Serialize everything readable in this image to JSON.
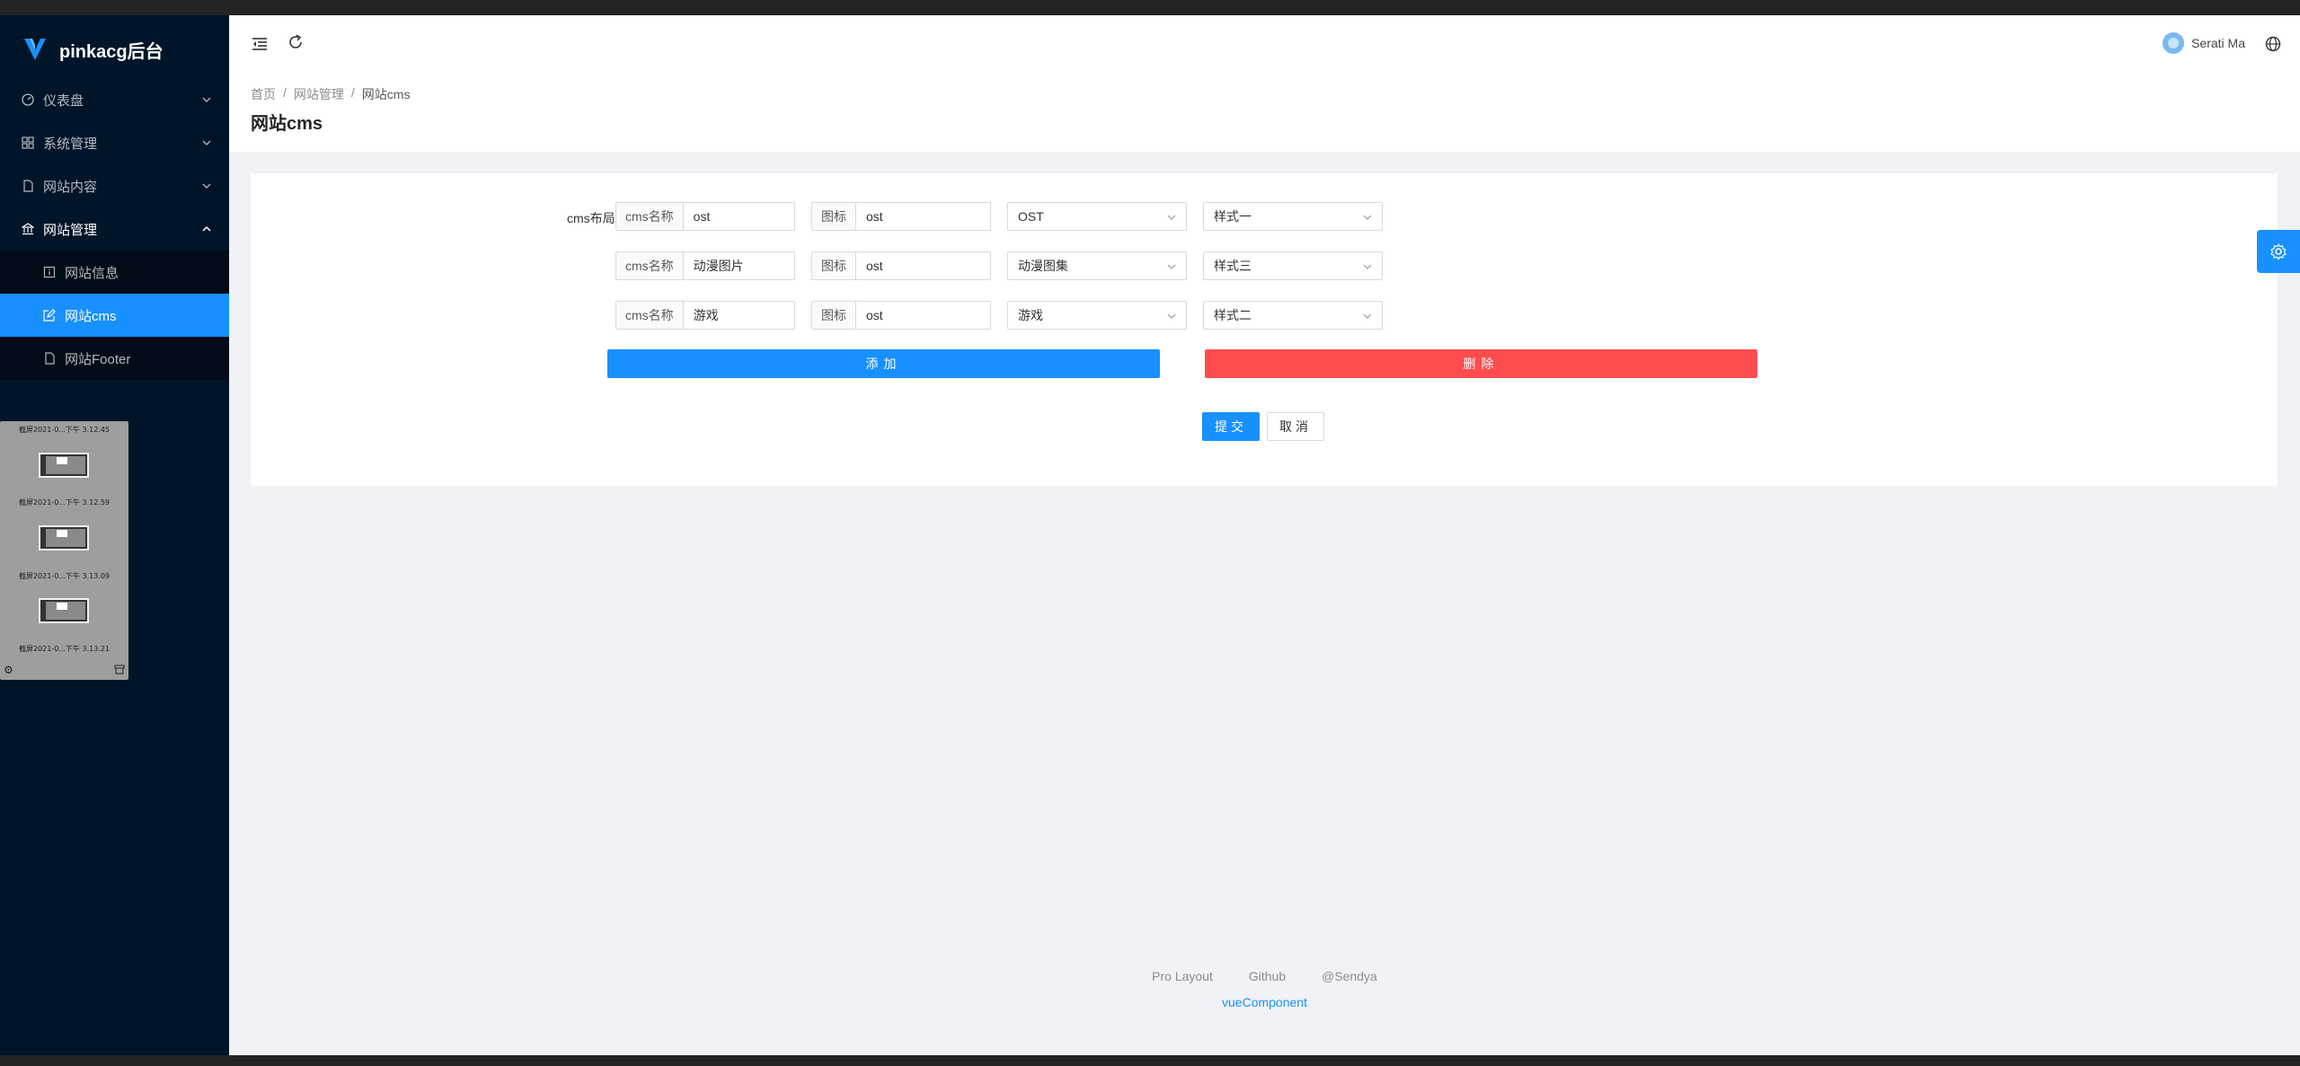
{
  "app": {
    "title": "pinkacg后台"
  },
  "sidebar": {
    "items": [
      {
        "label": "仪表盘",
        "icon": "dashboard-icon"
      },
      {
        "label": "系统管理",
        "icon": "appstore-icon"
      },
      {
        "label": "网站内容",
        "icon": "file-icon"
      },
      {
        "label": "网站管理",
        "icon": "bank-icon"
      }
    ],
    "subitems": [
      {
        "label": "网站信息",
        "icon": "info-icon"
      },
      {
        "label": "网站cms",
        "icon": "edit-icon"
      },
      {
        "label": "网站Footer",
        "icon": "file-icon"
      }
    ]
  },
  "screenshot_stack": {
    "captions": [
      "截屏2021-0...下午 3.12.45",
      "截屏2021-0...下午 3.12.59",
      "截屏2021-0...下午 3.13.09",
      "截屏2021-0...下午 3.13.21"
    ]
  },
  "header": {
    "user_name": "Serati Ma"
  },
  "breadcrumb": {
    "home": "首页",
    "section": "网站管理",
    "current": "网站cms"
  },
  "page": {
    "title": "网站cms"
  },
  "form": {
    "label": "cms布局:",
    "name_addon": "cms名称",
    "icon_addon": "图标",
    "rows": [
      {
        "name": "ost",
        "icon": "ost",
        "category": "OST",
        "style": "样式一"
      },
      {
        "name": "动漫图片",
        "icon": "ost",
        "category": "动漫图集",
        "style": "样式三"
      },
      {
        "name": "游戏",
        "icon": "ost",
        "category": "游戏",
        "style": "样式二"
      }
    ],
    "add_label": "添加",
    "delete_label": "删除",
    "submit_label": "提交",
    "cancel_label": "取消"
  },
  "footer": {
    "links": [
      "Pro Layout",
      "Github",
      "@Sendya"
    ],
    "component": "vueComponent"
  },
  "colors": {
    "primary": "#1890ff",
    "danger": "#ff4d4f",
    "sider": "#001529"
  }
}
